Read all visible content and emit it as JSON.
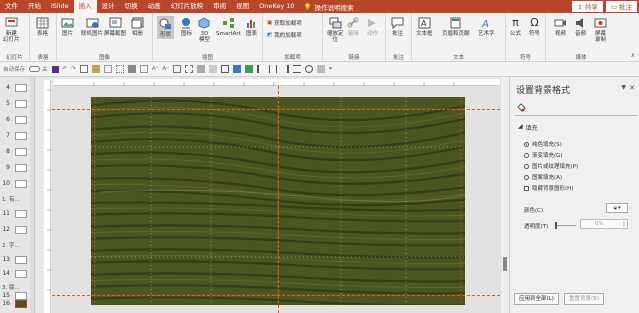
{
  "tabs": [
    "文件",
    "开始",
    "iSlide",
    "插入",
    "设计",
    "切换",
    "动画",
    "幻灯片放映",
    "审阅",
    "视图",
    "OneKey 10"
  ],
  "active_tab": "插入",
  "tell_me": "操作说明搜索",
  "share_label": "共享",
  "comment_label": "批注",
  "ribbon": {
    "groups": {
      "slides": "幻灯片",
      "tables": "表格",
      "images": "图像",
      "illustrations": "插图",
      "addins": "加载项",
      "links": "链接",
      "comments": "批注",
      "text": "文本",
      "symbols": "符号",
      "media": "媒体"
    },
    "new_slide": "新建\n幻灯片",
    "table": "表格",
    "pictures": "图片",
    "online_pictures": "联机图片",
    "screenshot": "屏幕截图",
    "album": "相册",
    "shapes": "形状",
    "icons": "图标",
    "models": "3D\n模型",
    "smartart": "SmartArt",
    "chart": "图表",
    "get_addins": "获取加载项",
    "my_addins": "我的加载项",
    "zoom": "缩放定\n位",
    "link": "链接",
    "action": "动作",
    "comment": "批注",
    "textbox": "文本框",
    "header_footer": "页眉和页脚",
    "wordart": "艺术字",
    "equation": "公式",
    "symbol": "符号",
    "video": "视频",
    "audio": "音频",
    "screen_record": "屏幕\n录制"
  },
  "quickbar_label": "自动保存",
  "quickbar_toggle": "关",
  "slide_numbers": [
    "4",
    "5",
    "6",
    "7",
    "8",
    "9",
    "10",
    "11",
    "12",
    "13",
    "14",
    "15",
    "16"
  ],
  "sections": [
    "1. 有...",
    "2. 字...",
    "3. 版..."
  ],
  "current_slide": "16",
  "pane": {
    "title": "设置背景格式",
    "fill_header": "填充",
    "options": [
      "纯色填充(S)",
      "渐变填充(G)",
      "图片或纹理填充(P)",
      "图案填充(A)"
    ],
    "selected_option": "纯色填充(S)",
    "hide_bg": "隐藏背景图形(H)",
    "color_label": "颜色(C)",
    "transparency_label": "透明度(T)",
    "transparency_value": "0%",
    "apply_all": "应用到全部(L)",
    "reset_bg": "重置背景(B)"
  },
  "colors": {
    "accent": "#b7472a",
    "slide_bg": "#4a5520"
  }
}
